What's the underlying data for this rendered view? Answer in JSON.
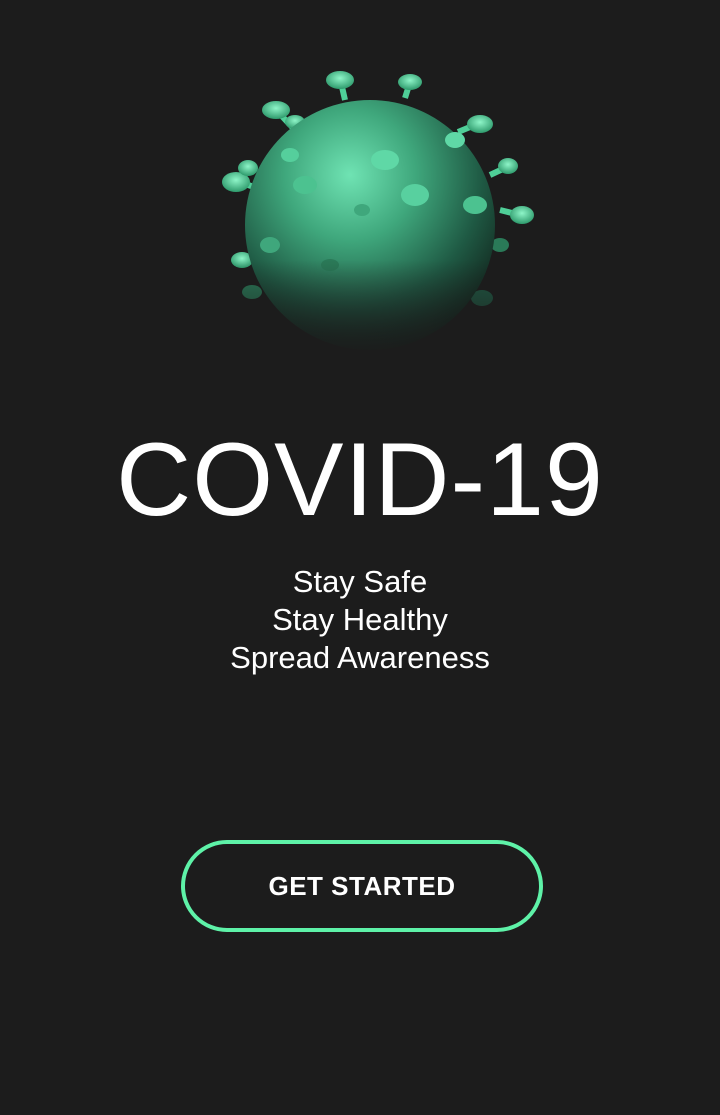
{
  "splash": {
    "title": "COVID-19",
    "tagline": [
      "Stay Safe",
      "Stay Healthy",
      "Spread Awareness"
    ],
    "cta_label": "GET STARTED"
  },
  "theme": {
    "background": "#1c1c1c",
    "accent": "#5ef2a8",
    "virus_color": "#3fbf8a"
  },
  "icons": {
    "hero": "coronavirus-illustration"
  }
}
